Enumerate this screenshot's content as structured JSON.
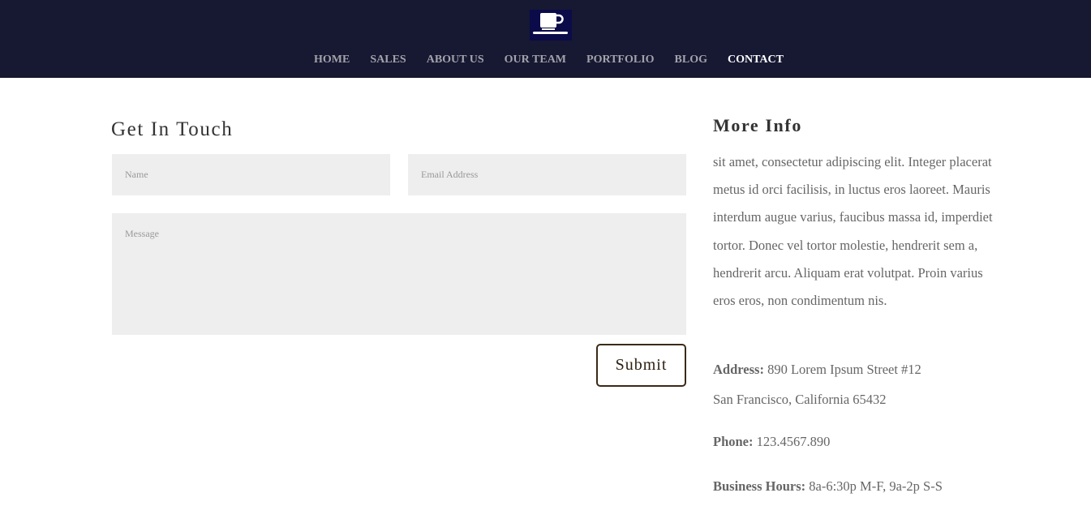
{
  "header": {
    "logo_icon": "coffee-cup-icon",
    "nav": [
      {
        "label": "HOME",
        "active": false
      },
      {
        "label": "SALES",
        "active": false
      },
      {
        "label": "ABOUT US",
        "active": false
      },
      {
        "label": "OUR TEAM",
        "active": false
      },
      {
        "label": "PORTFOLIO",
        "active": false
      },
      {
        "label": "BLOG",
        "active": false
      },
      {
        "label": "CONTACT",
        "active": true
      }
    ]
  },
  "contact_form": {
    "title": "Get In Touch",
    "name_placeholder": "Name",
    "email_placeholder": "Email Address",
    "message_placeholder": "Message",
    "submit_label": "Submit"
  },
  "more_info": {
    "title": "More Info",
    "paragraph": "sit amet, consectetur adipiscing elit. Integer placerat metus id orci facilisis, in luctus eros laoreet. Mauris interdum augue varius, faucibus massa id, imperdiet tortor. Donec vel tortor molestie, hendrerit sem a, hendrerit arcu. Aliquam erat volutpat. Proin varius eros eros, non condimentum nis.",
    "address_label": "Address:",
    "address_line1": "890 Lorem Ipsum Street #12",
    "address_line2": "San Francisco, California 65432",
    "phone_label": "Phone:",
    "phone": "123.4567.890",
    "hours_label": "Business Hours:",
    "hours": "8a-6:30p M-F, 9a-2p S-S"
  },
  "colors": {
    "header_bg": "#171832",
    "nav_text": "#a3a3ab",
    "nav_active": "#ffffff",
    "field_bg": "#eeeeee",
    "button_border": "#3a2a16"
  }
}
